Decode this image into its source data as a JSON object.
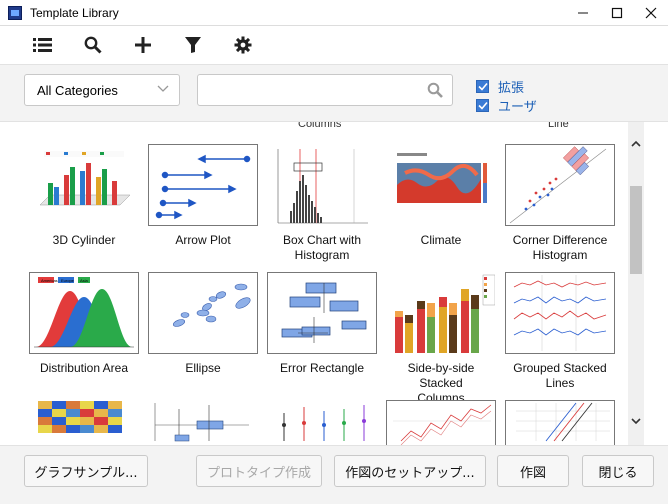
{
  "window": {
    "title": "Template Library",
    "controls": [
      "minimize-icon",
      "maximize-icon",
      "close-icon"
    ]
  },
  "toolbar": {
    "icons": [
      "list-view-icon",
      "search-icon",
      "add-icon",
      "filter-icon",
      "gear-icon"
    ]
  },
  "filter": {
    "category_value": "All Categories",
    "search_value": "",
    "search_placeholder": "",
    "checkbox_extension": {
      "label": "拡張",
      "checked": true
    },
    "checkbox_user": {
      "label": "ユーザ",
      "checked": true
    }
  },
  "gallery": {
    "partial_labels": [
      "Columns",
      "Line"
    ],
    "tiles": [
      {
        "name": "3D Cylinder"
      },
      {
        "name": "Arrow Plot"
      },
      {
        "name": "Box Chart with\nHistogram"
      },
      {
        "name": "Climate"
      },
      {
        "name": "Corner Difference\nHistogram"
      },
      {
        "name": "Distribution Area",
        "legend": [
          "Americas",
          "Europe",
          "Asia"
        ]
      },
      {
        "name": "Ellipse"
      },
      {
        "name": "Error Rectangle"
      },
      {
        "name": "Side-by-side Stacked\nColumns"
      },
      {
        "name": "Grouped Stacked\nLines"
      }
    ]
  },
  "footer": {
    "graph_sample": "グラフサンプル...",
    "prototype": "プロトタイプ作成",
    "setup": "作図のセットアップ...",
    "plot": "作図",
    "close": "閉じる"
  },
  "colors": {
    "accent": "#3a7bd5",
    "checkbox_label": "#1b5fb6",
    "panel_bg": "#f3f3f3"
  }
}
